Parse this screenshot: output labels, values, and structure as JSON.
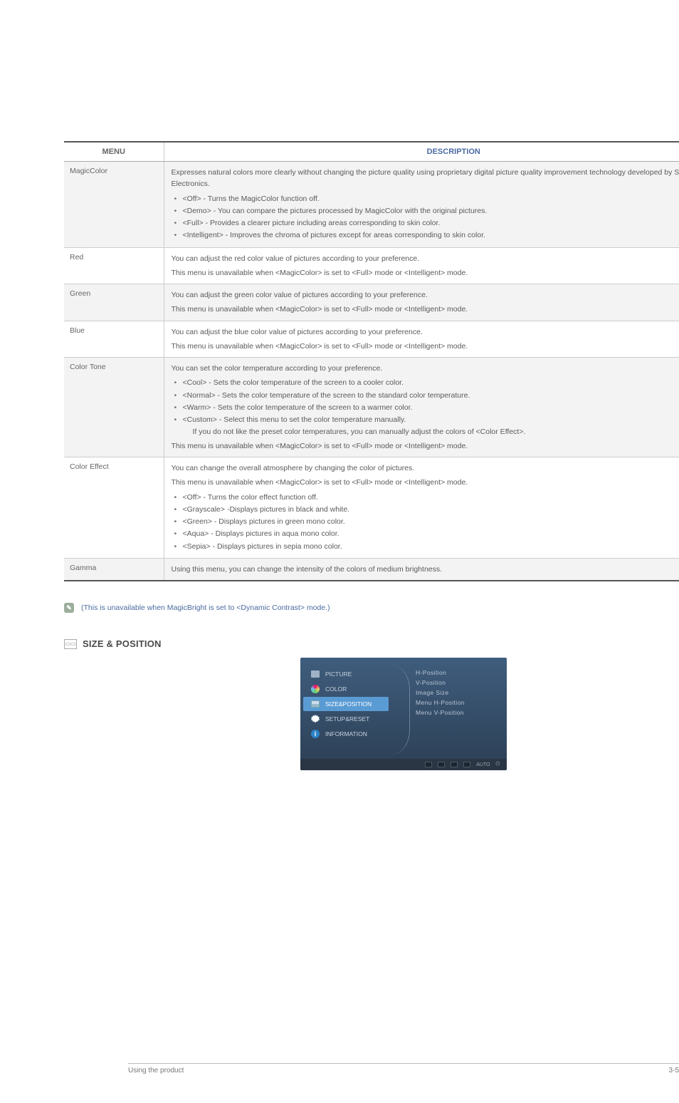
{
  "table": {
    "headers": [
      "MENU",
      "DESCRIPTION"
    ],
    "rows": [
      {
        "menu": "MagicColor",
        "shade": true,
        "intro": "Expresses natural colors more clearly without changing the picture quality using proprietary digital picture quality improvement technology developed by Samsung Electronics.",
        "bullets": [
          "<Off> - Turns the MagicColor function off.",
          "<Demo> - You can compare the pictures processed by MagicColor with the original pictures.",
          "<Full> - Provides a clearer picture including areas corresponding to skin color.",
          "<Intelligent> - Improves the chroma of pictures except for areas corresponding to skin color."
        ]
      },
      {
        "menu": "Red",
        "shade": false,
        "intro": "You can adjust the red color value of pictures according to your preference.",
        "outro": "This menu is unavailable when <MagicColor> is set to <Full> mode or <Intelligent> mode."
      },
      {
        "menu": "Green",
        "shade": true,
        "intro": "You can adjust the green color value of pictures according to your preference.",
        "outro": "This menu is unavailable when <MagicColor> is set to <Full> mode or <Intelligent> mode."
      },
      {
        "menu": "Blue",
        "shade": false,
        "intro": "You can adjust the blue color value of pictures according to your preference.",
        "outro": "This menu is unavailable when <MagicColor> is set to <Full> mode or <Intelligent> mode."
      },
      {
        "menu": "Color Tone",
        "shade": true,
        "intro": "You can set the color temperature according to your preference.",
        "bullets": [
          "<Cool> - Sets the color temperature of the screen to a cooler color.",
          "<Normal> - Sets the color temperature of the screen to the standard color temperature.",
          "<Warm> - Sets the color temperature of the screen to a warmer color.",
          "<Custom> - Select this menu to set the color temperature manually."
        ],
        "sub_after_last": "If you do not like the preset color temperatures, you can manually adjust the colors of <Color Effect>.",
        "outro": "This menu is unavailable when <MagicColor> is set to <Full> mode or <Intelligent> mode."
      },
      {
        "menu": "Color Effect",
        "shade": false,
        "intro": "You can change the overall atmosphere by changing the color of pictures.",
        "intro2": "This menu is unavailable when <MagicColor> is set to <Full> mode or <Intelligent> mode.",
        "bullets": [
          "<Off> - Turns the color effect function off.",
          "<Grayscale> -Displays pictures in black and white.",
          "<Green> - Displays pictures in green mono color.",
          "<Aqua> - Displays pictures in aqua mono color.",
          "<Sepia> - Displays pictures in sepia mono color."
        ]
      },
      {
        "menu": "Gamma",
        "shade": true,
        "intro": "Using this menu, you can change the intensity of the colors of medium brightness."
      }
    ]
  },
  "note": "(This is unavailable when MagicBright is set to <Dynamic Contrast> mode.)",
  "section": {
    "title": "SIZE & POSITION"
  },
  "osd": {
    "left_items": [
      {
        "label": "PICTURE",
        "icon": "box"
      },
      {
        "label": "COLOR",
        "icon": "pal"
      },
      {
        "label": "SIZE&POSITION",
        "icon": "grid",
        "selected": true
      },
      {
        "label": "SETUP&RESET",
        "icon": "gear"
      },
      {
        "label": "INFORMATION",
        "icon": "info"
      }
    ],
    "right_items": [
      "H-Position",
      "V-Position",
      "Image Size",
      "Menu H-Position",
      "Menu V-Position"
    ],
    "bottom_label": "AUTO"
  },
  "footer": {
    "left": "Using the product",
    "right": "3-5"
  }
}
